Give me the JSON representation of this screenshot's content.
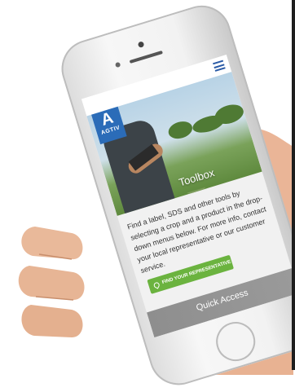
{
  "screen": {
    "logo": {
      "mark": "A",
      "text": "AGTIV"
    },
    "section_title": "Toolbox",
    "intro_text": "Find a label, SDS and other tools by selecting a crop and a product in the drop-down menus below. For more info, contact your local representative or our customer service.",
    "find_rep_label": "FIND YOUR REPRESENTATIVE",
    "quick_access_label": "Quick Access"
  },
  "colors": {
    "brand_blue": "#2b6cb8",
    "button_green": "#6bb33f",
    "quick_access_gray": "#8e8e8e"
  },
  "icons": [
    "menu-icon",
    "location-pin-icon"
  ]
}
